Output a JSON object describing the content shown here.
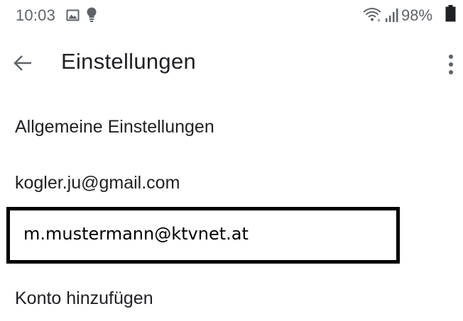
{
  "status_bar": {
    "time": "10:03",
    "battery_percent": "98%",
    "icons": [
      "image-icon",
      "lightbulb-icon",
      "wifi-icon",
      "signal-icon",
      "battery-icon"
    ]
  },
  "app_bar": {
    "title": "Einstellungen",
    "back_icon": "arrow-back-icon",
    "overflow_icon": "more-vert-icon"
  },
  "settings": {
    "items": [
      {
        "label": "Allgemeine Einstellungen"
      },
      {
        "label": "kogler.ju@gmail.com"
      },
      {
        "label": "m.mustermann@ktvnet.at"
      },
      {
        "label": "Konto hinzufügen"
      }
    ]
  },
  "colors": {
    "text_primary": "#202124",
    "text_secondary": "#5f6368",
    "highlight_border": "#000000",
    "background": "#ffffff"
  }
}
